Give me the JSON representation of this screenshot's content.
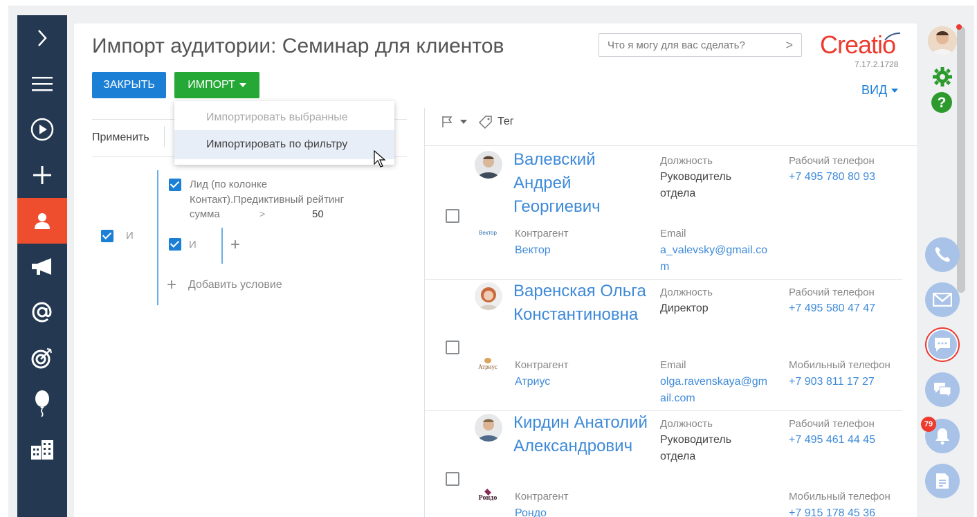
{
  "header": {
    "title": "Импорт аудитории: Семинар для клиентов",
    "close_label": "ЗАКРЫТЬ",
    "import_label": "ИМПОРТ",
    "search_placeholder": "Что я могу для вас сделать?",
    "search_arrow": ">",
    "logo_text": "Creatio",
    "version": "7.17.2.1728",
    "view_label": "ВИД"
  },
  "dropdown": {
    "items": [
      {
        "label": "Импортировать выбранные",
        "enabled": false
      },
      {
        "label": "Импортировать по фильтру",
        "enabled": true,
        "hovered": true
      }
    ]
  },
  "filter": {
    "apply_label": "Применить",
    "group_and": "И",
    "condition_text": "Лид (по колонке Контакт).Предиктивный рейтинг",
    "condition_field": "сумма",
    "condition_operator": ">",
    "condition_value": "50",
    "sub_group_and": "И",
    "sub_add_plus": "+",
    "add_condition_plus": "+",
    "add_condition_label": "Добавить условие"
  },
  "list": {
    "tag_label": "Тег",
    "records": [
      {
        "name": "Валевский Андрей Георгиевич",
        "position_label": "Должность",
        "position": "Руководитель отдела",
        "phone_label": "Рабочий телефон",
        "phone": "+7 495 780 80 93",
        "account_label": "Контрагент",
        "account": "Вектор",
        "account_logo": "Вектор",
        "email_label": "Email",
        "email": "a_valevsky@gmail.com",
        "phone2_label": "",
        "phone2": ""
      },
      {
        "name": "Варенская Ольга Константиновна",
        "position_label": "Должность",
        "position": "Директор",
        "phone_label": "Рабочий телефон",
        "phone": "+7 495 580 47 47",
        "account_label": "Контрагент",
        "account": "Атриус",
        "account_logo": "Атриус",
        "email_label": "Email",
        "email": "olga.ravenskaya@gmail.com",
        "phone2_label": "Мобильный телефон",
        "phone2": "+7 903 811 17 27"
      },
      {
        "name": "Кирдин Анатолий Александрович",
        "position_label": "Должность",
        "position": "Руководитель отдела",
        "phone_label": "Рабочий телефон",
        "phone": "+7 495 461 44 45",
        "account_label": "Контрагент",
        "account": "Рондо",
        "account_logo": "Рондо",
        "email_label": "",
        "email": "",
        "phone2_label": "Мобильный телефон",
        "phone2": "+7 915 178 45 36"
      }
    ]
  },
  "right_rail": {
    "notification_count": "79",
    "buttons": [
      "phone-icon",
      "mail-icon",
      "chat-icon",
      "feed-icon",
      "bell-icon",
      "document-icon"
    ]
  },
  "left_nav": {
    "items": [
      "chevron-right-icon",
      "menu-icon",
      "play-icon",
      "plus-icon",
      "contacts-icon",
      "megaphone-icon",
      "at-icon",
      "target-icon",
      "balloon-icon",
      "buildings-icon"
    ],
    "active_index": 4
  },
  "colors": {
    "nav_bg": "#243951",
    "nav_active": "#ee4d2e",
    "primary_blue": "#1b7fd6",
    "import_green": "#25a835",
    "logo_red": "#ee3a2e",
    "link_blue": "#3e8ad8"
  }
}
